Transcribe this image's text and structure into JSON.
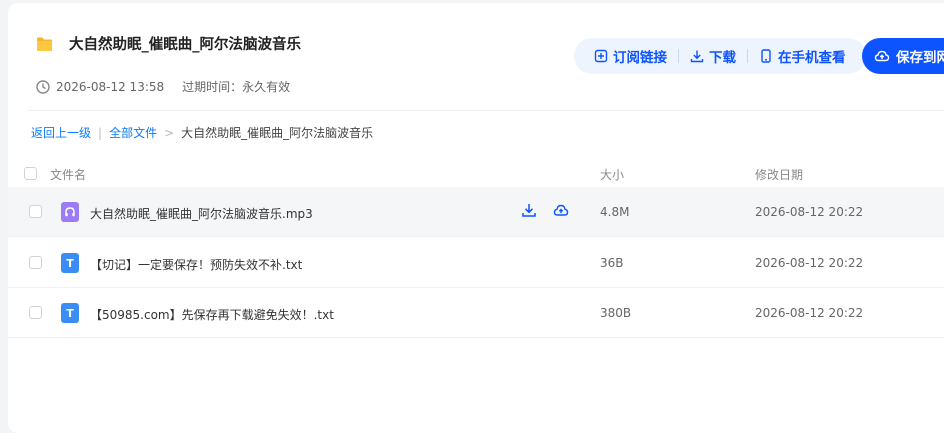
{
  "header": {
    "title": "大自然助眠_催眠曲_阿尔法脑波音乐",
    "date": "2026-08-12 13:58",
    "expire_label": "过期时间：",
    "expire_value": "永久有效"
  },
  "actions": {
    "subscribe": "订阅链接",
    "download": "下载",
    "mobile": "在手机查看",
    "save": "保存到网盘"
  },
  "breadcrumb": {
    "back": "返回上一级",
    "sep1": "|",
    "all": "全部文件",
    "sep2": ">",
    "current": "大自然助眠_催眠曲_阿尔法脑波音乐"
  },
  "table": {
    "headers": {
      "name": "文件名",
      "size": "大小",
      "date": "修改日期"
    },
    "rows": [
      {
        "name": "大自然助眠_催眠曲_阿尔法脑波音乐.mp3",
        "size": "4.8M",
        "date": "2026-08-12 20:22",
        "type": "audio"
      },
      {
        "name": "【切记】一定要保存！预防失效不补.txt",
        "size": "36B",
        "date": "2026-08-12 20:22",
        "type": "text"
      },
      {
        "name": "【50985.com】先保存再下载避免失效！.txt",
        "size": "380B",
        "date": "2026-08-12 20:22",
        "type": "text"
      }
    ]
  },
  "colors": {
    "accent": "#0d53ff",
    "link": "#0d7bff",
    "folder": "#f5b52a"
  }
}
